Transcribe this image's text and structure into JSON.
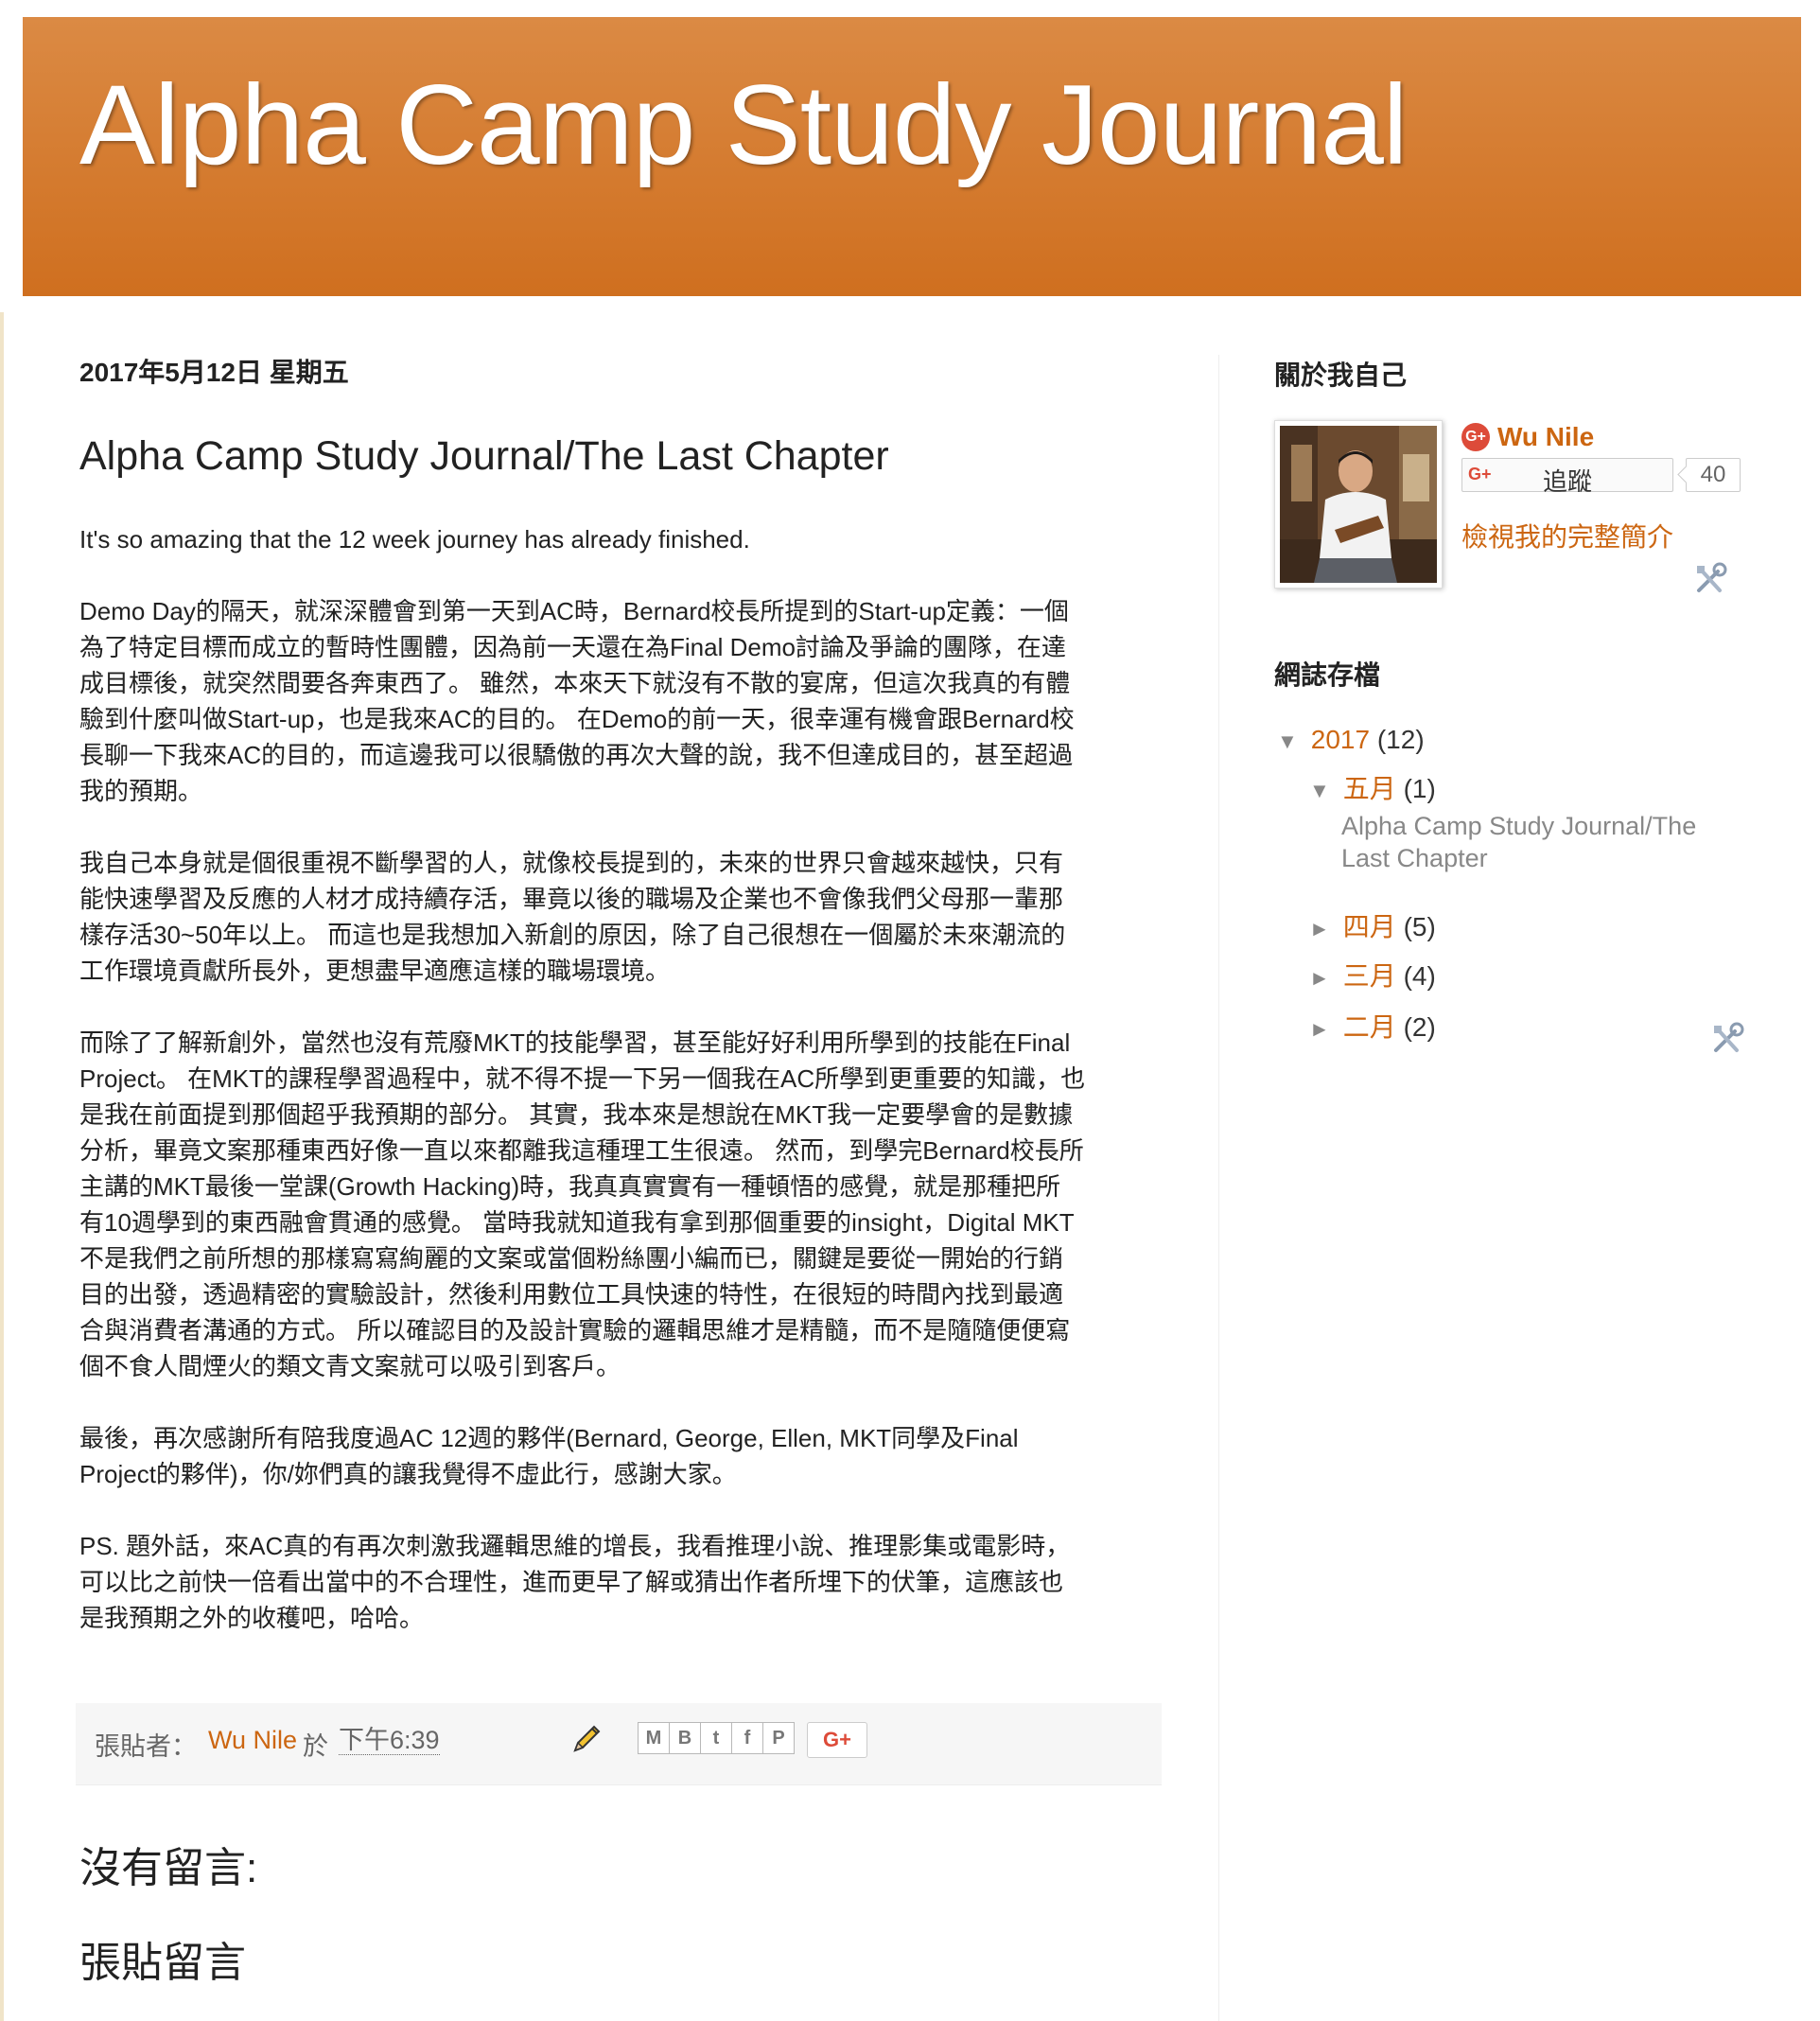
{
  "blog": {
    "title": "Alpha Camp Study Journal"
  },
  "post": {
    "date": "2017年5月12日 星期五",
    "title": "Alpha Camp Study Journal/The Last Chapter",
    "paragraphs": [
      "It's so amazing that the 12 week journey has already finished.",
      "Demo Day的隔天，就深深體會到第一天到AC時，Bernard校長所提到的Start-up定義：一個\n為了特定目標而成立的暫時性團體，因為前一天還在為Final Demo討論及爭論的團隊，在達\n成目標後，就突然間要各奔東西了。 雖然，本來天下就沒有不散的宴席，但這次我真的有體\n驗到什麼叫做Start-up，也是我來AC的目的。 在Demo的前一天，很幸運有機會跟Bernard校\n長聊一下我來AC的目的，而這邊我可以很驕傲的再次大聲的說，我不但達成目的，甚至超過\n我的預期。",
      "我自己本身就是個很重視不斷學習的人，就像校長提到的，未來的世界只會越來越快，只有\n能快速學習及反應的人材才成持續存活，畢竟以後的職場及企業也不會像我們父母那一輩那\n樣存活30~50年以上。 而這也是我想加入新創的原因，除了自己很想在一個屬於未來潮流的\n工作環境貢獻所長外，更想盡早適應這樣的職場環境。",
      "而除了了解新創外，當然也沒有荒廢MKT的技能學習，甚至能好好利用所學到的技能在Final\nProject。 在MKT的課程學習過程中，就不得不提一下另一個我在AC所學到更重要的知識，也\n是我在前面提到那個超乎我預期的部分。 其實，我本來是想說在MKT我一定要學會的是數據\n分析，畢竟文案那種東西好像一直以來都離我這種理工生很遠。 然而，到學完Bernard校長所\n主講的MKT最後一堂課(Growth Hacking)時，我真真實實有一種頓悟的感覺，就是那種把所\n有10週學到的東西融會貫通的感覺。 當時我就知道我有拿到那個重要的insight，Digital MKT\n不是我們之前所想的那樣寫寫絢麗的文案或當個粉絲團小編而已，關鍵是要從一開始的行銷\n目的出發，透過精密的實驗設計，然後利用數位工具快速的特性，在很短的時間內找到最適\n合與消費者溝通的方式。 所以確認目的及設計實驗的邏輯思維才是精髓，而不是隨隨便便寫\n個不食人間煙火的類文青文案就可以吸引到客戶。",
      "最後，再次感謝所有陪我度過AC 12週的夥伴(Bernard, George, Ellen, MKT同學及Final\nProject的夥伴)，你/妳們真的讓我覺得不虛此行，感謝大家。",
      "PS. 題外話，來AC真的有再次刺激我邏輯思維的增長，我看推理小說、推理影集或電影時，\n可以比之前快一倍看出當中的不合理性，進而更早了解或猜出作者所埋下的伏筆，這應該也\n是我預期之外的收穫吧，哈哈。"
    ],
    "footer": {
      "posted_by_label": "張貼者：",
      "author": "Wu Nile",
      "at": "於",
      "time": "下午6:39"
    },
    "share": {
      "buttons": [
        "email-icon",
        "blogger-icon",
        "twitter-icon",
        "facebook-icon",
        "pinterest-icon"
      ],
      "gplus_label": "G+"
    }
  },
  "comments": {
    "heading": "沒有留言:",
    "post_comment_heading": "張貼留言"
  },
  "sidebar": {
    "about": {
      "heading": "關於我自己",
      "name": "Wu Nile",
      "follow_g": "G+",
      "follow_label": "追蹤",
      "follow_count": "40",
      "profile_link": "檢視我的完整簡介"
    },
    "archive": {
      "heading": "網誌存檔",
      "year": {
        "label": "2017",
        "count": "(12)",
        "arrow": "▼"
      },
      "months": [
        {
          "label": "五月",
          "count": "(1)",
          "arrow": "▼"
        },
        {
          "label": "四月",
          "count": "(5)",
          "arrow": "►"
        },
        {
          "label": "三月",
          "count": "(4)",
          "arrow": "►"
        },
        {
          "label": "二月",
          "count": "(2)",
          "arrow": "►"
        }
      ],
      "current_post": "Alpha Camp Study Journal/The Last Chapter"
    }
  },
  "colors": {
    "header_top": "#db8a44",
    "header_bottom": "#cf6f1f",
    "link": "#cc6611",
    "gplus": "#dd4b39"
  }
}
